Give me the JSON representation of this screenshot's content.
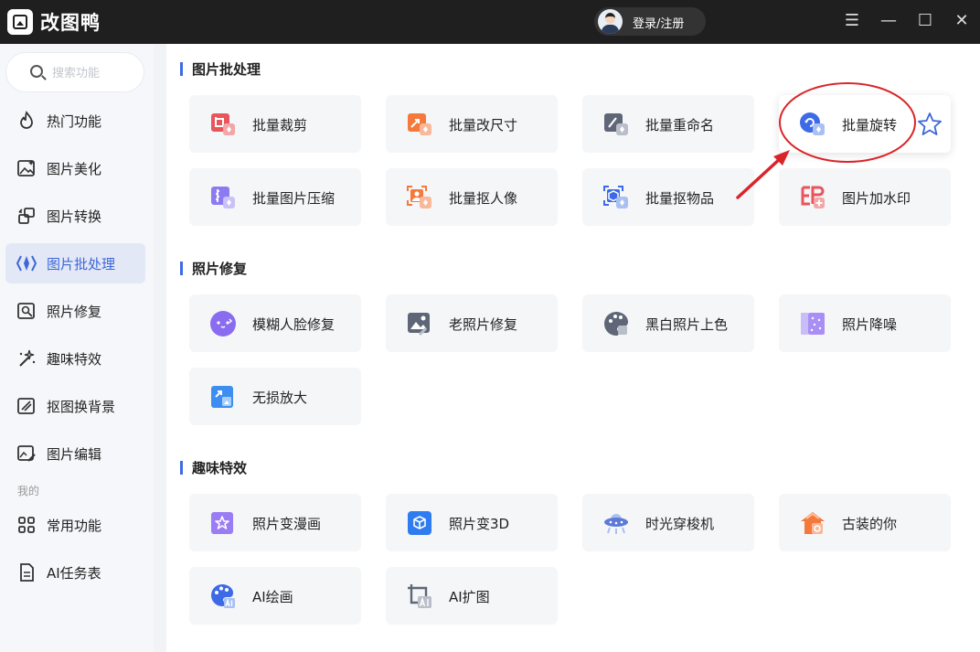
{
  "app": {
    "title": "改图鸭",
    "login_label": "登录/注册"
  },
  "window_controls": [
    "menu-icon",
    "minimize-icon",
    "maximize-icon",
    "close-icon"
  ],
  "sidebar": {
    "search_placeholder": "搜索功能",
    "items": [
      {
        "label": "热门功能",
        "icon": "fire-icon"
      },
      {
        "label": "图片美化",
        "icon": "image-beautify-icon"
      },
      {
        "label": "图片转换",
        "icon": "convert-icon"
      },
      {
        "label": "图片批处理",
        "icon": "batch-icon",
        "active": true
      },
      {
        "label": "照片修复",
        "icon": "photo-repair-icon"
      },
      {
        "label": "趣味特效",
        "icon": "sparkle-icon"
      },
      {
        "label": "抠图换背景",
        "icon": "cutout-icon"
      },
      {
        "label": "图片编辑",
        "icon": "image-edit-icon"
      }
    ],
    "mine_label": "我的",
    "mine_items": [
      {
        "label": "常用功能",
        "icon": "grid-icon"
      },
      {
        "label": "AI任务表",
        "icon": "task-list-icon"
      }
    ]
  },
  "sections": [
    {
      "title": "图片批处理",
      "cards": [
        {
          "label": "批量裁剪",
          "icon": "crop-icon",
          "color": "#e8565b"
        },
        {
          "label": "批量改尺寸",
          "icon": "resize-icon",
          "color": "#f5793b"
        },
        {
          "label": "批量重命名",
          "icon": "rename-icon",
          "color": "#5e6677"
        },
        {
          "label": "批量旋转",
          "icon": "rotate-icon",
          "color": "#3d6ae6",
          "highlighted": true
        },
        {
          "label": "批量图片压缩",
          "icon": "compress-icon",
          "color": "#8a7cf0"
        },
        {
          "label": "批量抠人像",
          "icon": "portrait-cutout-icon",
          "color": "#f5793b"
        },
        {
          "label": "批量抠物品",
          "icon": "object-cutout-icon",
          "color": "#3d6ae6"
        },
        {
          "label": "图片加水印",
          "icon": "watermark-icon",
          "color": "#e8565b"
        }
      ]
    },
    {
      "title": "照片修复",
      "cards": [
        {
          "label": "模糊人脸修复",
          "icon": "face-repair-icon",
          "color": "#8a6cf0"
        },
        {
          "label": "老照片修复",
          "icon": "old-photo-icon",
          "color": "#5e6677"
        },
        {
          "label": "黑白照片上色",
          "icon": "palette-icon",
          "color": "#5e6677"
        },
        {
          "label": "照片降噪",
          "icon": "denoise-icon",
          "color": "#a98ff5"
        },
        {
          "label": "无损放大",
          "icon": "enlarge-icon",
          "color": "#3d8ef0"
        }
      ]
    },
    {
      "title": "趣味特效",
      "cards": [
        {
          "label": "照片变漫画",
          "icon": "comic-icon",
          "color": "#9a7cf5"
        },
        {
          "label": "照片变3D",
          "icon": "cube-3d-icon",
          "color": "#2f7cf0"
        },
        {
          "label": "时光穿梭机",
          "icon": "time-machine-icon",
          "color": "#5e7ad6"
        },
        {
          "label": "古装的你",
          "icon": "costume-icon",
          "color": "#f5793b"
        },
        {
          "label": "AI绘画",
          "icon": "ai-paint-icon",
          "color": "#3d6ae6"
        },
        {
          "label": "AI扩图",
          "icon": "ai-expand-icon",
          "color": "#5e6677"
        }
      ]
    }
  ],
  "colors": {
    "accent": "#3d67d9",
    "annotation": "#d9252a",
    "titlebar": "#1f1f1f"
  }
}
